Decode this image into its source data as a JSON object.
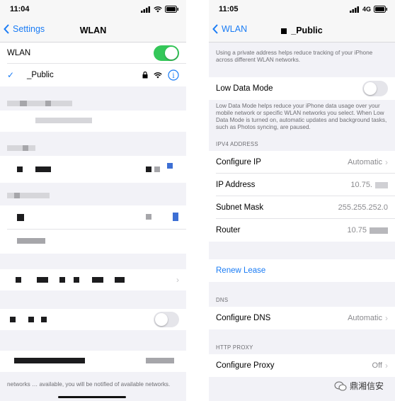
{
  "left": {
    "status": {
      "time": "11:04"
    },
    "nav": {
      "back_label": "Settings",
      "title": "WLAN"
    },
    "wlan_label": "WLAN",
    "wlan_toggle_on": true,
    "network": {
      "name": "_Public"
    },
    "footer_note": "networks … available, you will be notified of available networks."
  },
  "right": {
    "status": {
      "time": "11:05",
      "network": "4G"
    },
    "nav": {
      "back_label": "WLAN",
      "title": "_Public"
    },
    "private_note": "Using a private address helps reduce tracking of your iPhone across different WLAN networks.",
    "low_data": {
      "label": "Low Data Mode",
      "on": false,
      "note": "Low Data Mode helps reduce your iPhone data usage over your mobile network or specific WLAN networks you select. When Low Data Mode is turned on, automatic updates and background tasks, such as Photos syncing, are paused."
    },
    "ipv4": {
      "header": "IPV4 ADDRESS",
      "configure_ip": {
        "label": "Configure IP",
        "value": "Automatic"
      },
      "ip_address": {
        "label": "IP Address",
        "value": "10.75."
      },
      "subnet": {
        "label": "Subnet Mask",
        "value": "255.255.252.0"
      },
      "router": {
        "label": "Router",
        "value": "10.75"
      }
    },
    "renew_lease": "Renew Lease",
    "dns": {
      "header": "DNS",
      "label": "Configure DNS",
      "value": "Automatic"
    },
    "proxy": {
      "header": "HTTP PROXY",
      "label": "Configure Proxy",
      "value": "Off"
    }
  },
  "watermark": "鼎湘信安",
  "colors": {
    "accent": "#1a7cf5",
    "toggle_on": "#34c759",
    "toggle_off": "#e5e5ea"
  }
}
